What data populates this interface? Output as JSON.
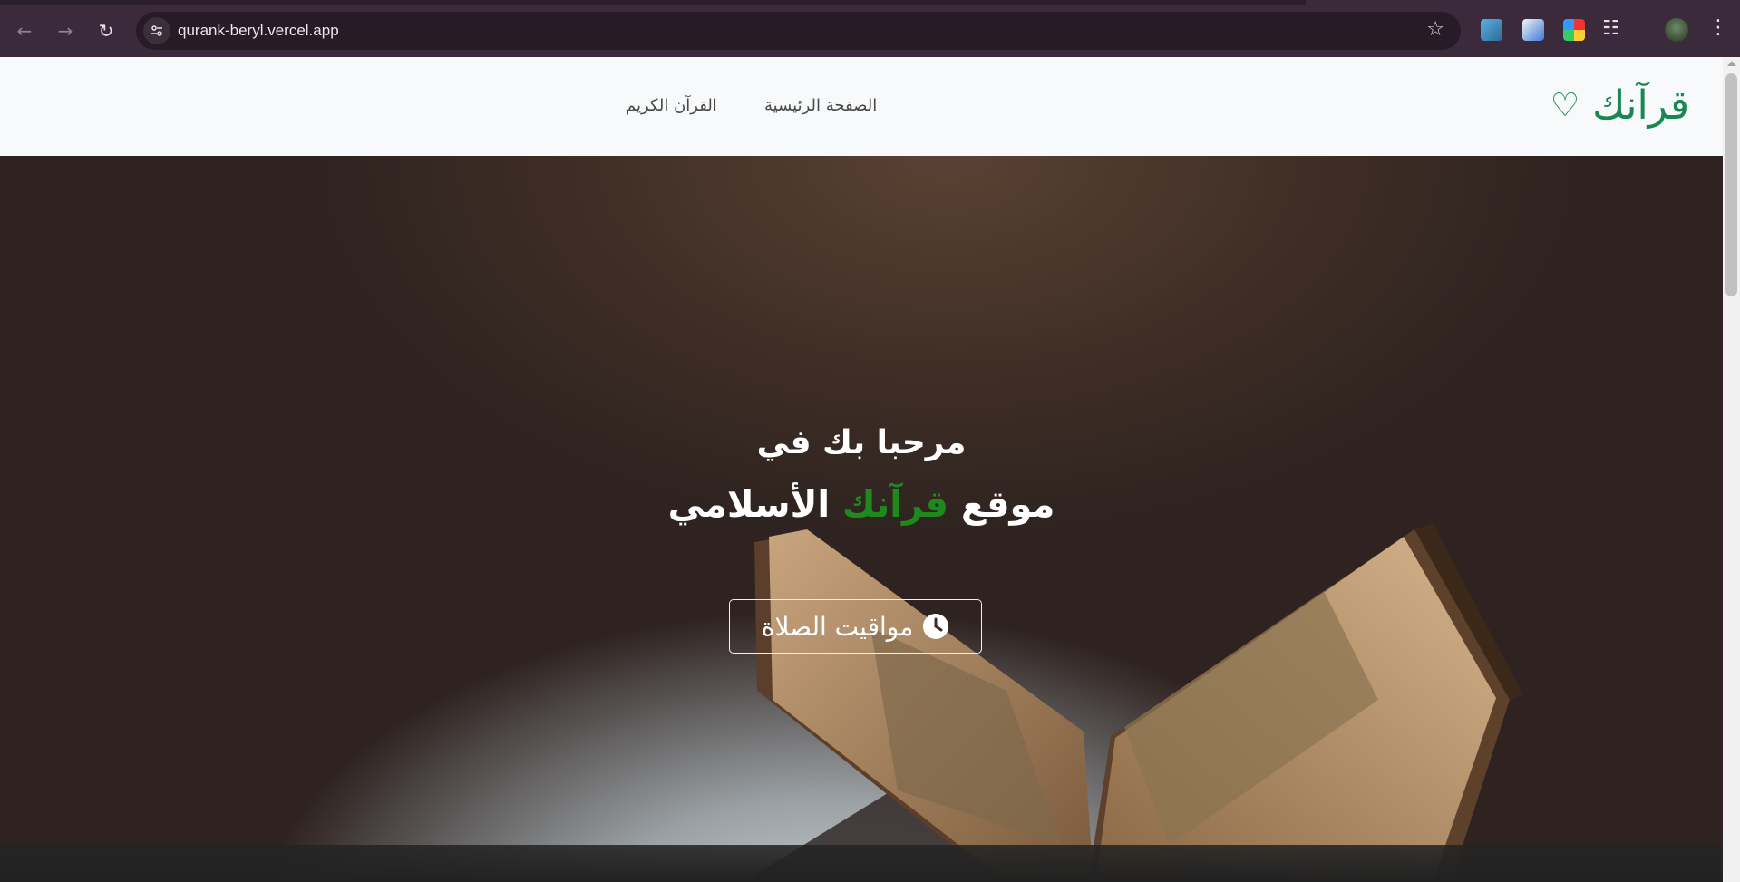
{
  "browser": {
    "url": "qurank-beryl.vercel.app",
    "icons": {
      "back": "arrow-left-icon",
      "forward": "arrow-right-icon",
      "reload": "reload-icon",
      "site_info": "tune-icon",
      "bookmark": "star-icon",
      "extensions": "puzzle-icon",
      "menu": "more-vert-icon"
    }
  },
  "navbar": {
    "brand": "قرآنك",
    "brand_icon": "heart-icon",
    "links": [
      "الصفحة الرئيسية",
      "القرآن الكريم"
    ]
  },
  "hero": {
    "line1": "مرحبا بك في",
    "line2_prefix": "موقع",
    "line2_highlight": "قرآنك",
    "line2_suffix": "الأسلامي",
    "button_label": "مواقيت الصلاة",
    "button_icon": "clock-icon"
  },
  "colors": {
    "brand_green": "#198754",
    "highlight_green": "#1e8a1e",
    "chrome_bg": "#3a2a3c",
    "navbar_bg": "#f8f9fa"
  }
}
